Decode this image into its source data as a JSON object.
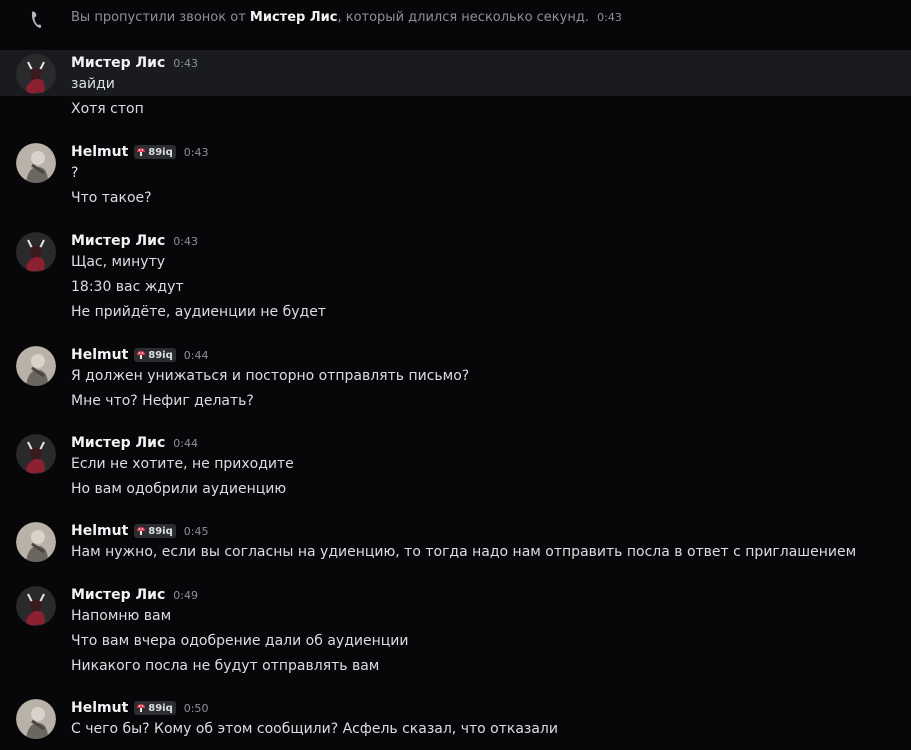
{
  "call_notice": {
    "prefix": "Вы пропустили звонок от",
    "caller": "Мистер Лис",
    "suffix": ", который длился несколько секунд.",
    "time": "0:43"
  },
  "colors": {
    "background": "#070709",
    "highlight_row": "#1a1b1e",
    "timestamp": "#8d9099",
    "text": "#dbdee1"
  },
  "users": {
    "lis": {
      "name": "Мистер Лис",
      "avatar_icon": "fox-avatar-icon"
    },
    "helmut": {
      "name": "Helmut",
      "tag": "89iq",
      "avatar_icon": "helmut-avatar-icon",
      "tag_icon": "mushroom-icon"
    }
  },
  "messages": [
    {
      "author": "Мистер Лис",
      "time": "0:43",
      "lines": [
        "зайди",
        "Хотя стоп"
      ]
    },
    {
      "author": "Helmut",
      "tag": "89iq",
      "time": "0:43",
      "lines": [
        "?",
        "Что такое?"
      ]
    },
    {
      "author": "Мистер Лис",
      "time": "0:43",
      "lines": [
        "Щас, минуту",
        "18:30 вас ждут",
        "Не прийдёте, аудиенции не будет"
      ]
    },
    {
      "author": "Helmut",
      "tag": "89iq",
      "time": "0:44",
      "lines": [
        "Я должен унижаться и посторно отправлять письмо?",
        "Мне что? Нефиг делать?"
      ]
    },
    {
      "author": "Мистер Лис",
      "time": "0:44",
      "lines": [
        "Если не хотите, не приходите",
        "Но вам одобрили аудиенцию"
      ]
    },
    {
      "author": "Helmut",
      "tag": "89iq",
      "time": "0:45",
      "lines": [
        "Нам нужно, если вы согласны на удиенцию, то тогда надо нам отправить посла в ответ с приглашением"
      ]
    },
    {
      "author": "Мистер Лис",
      "time": "0:49",
      "lines": [
        "Напомню вам",
        "Что вам вчера одобрение дали об аудиенции",
        "Никакого посла не будут отправлять вам"
      ]
    },
    {
      "author": "Helmut",
      "tag": "89iq",
      "time": "0:50",
      "lines": [
        "С чего бы? Кому об этом сообщили? Асфель сказал, что отказали"
      ]
    }
  ]
}
